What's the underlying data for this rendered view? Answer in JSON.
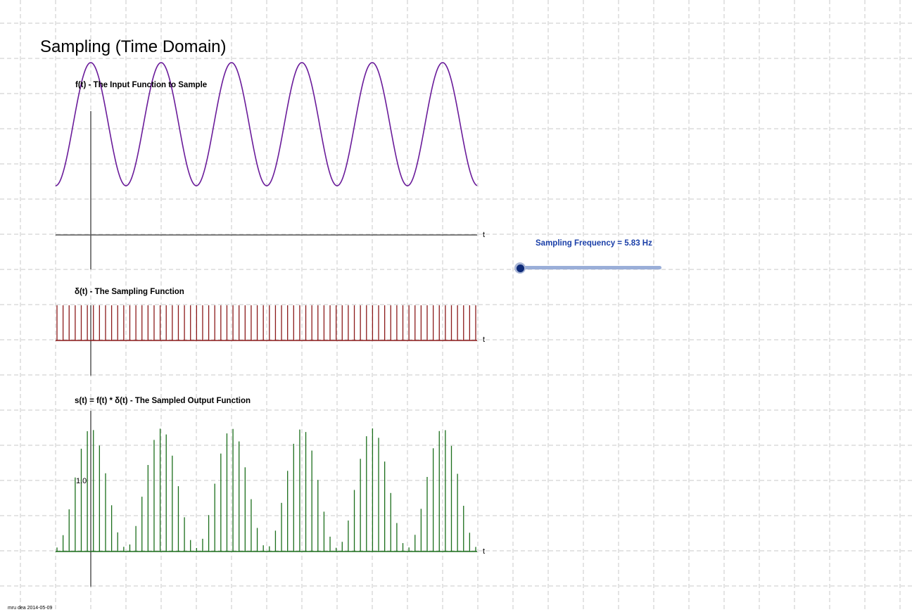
{
  "title": "Sampling (Time Domain)",
  "footer": "mru dea 2014-05-09",
  "colors": {
    "grid": "#c8c8c8",
    "axis": "#555555",
    "input": "#6a1b9a",
    "sampling": "#8b1a1a",
    "output": "#1b6e1b",
    "slider_label": "#1a3fa8",
    "slider_track": "#9aaed8",
    "slider_handle": "#0d2a78"
  },
  "slider": {
    "label": "Sampling Frequency = 5.83 Hz",
    "value": 5.83,
    "position": 0
  },
  "chart_data": [
    {
      "type": "line",
      "title": "f(t) - The Input Function to Sample",
      "xlabel": "t",
      "ylabel": "",
      "function": "cos",
      "periods_visible": 6,
      "y_range": [
        0,
        1.75
      ]
    },
    {
      "type": "bar",
      "title": "δ(t) - The Sampling Function",
      "xlabel": "t",
      "ylabel": "",
      "pulse_count": 70,
      "pulse_height": 1
    },
    {
      "type": "bar",
      "title": "s(t) = f(t) * δ(t) - The Sampled Output Function",
      "xlabel": "t",
      "ylabel": "",
      "ytick_labels": [
        "1.0"
      ],
      "pulse_count": 70,
      "y_range": [
        0,
        1.75
      ]
    }
  ]
}
